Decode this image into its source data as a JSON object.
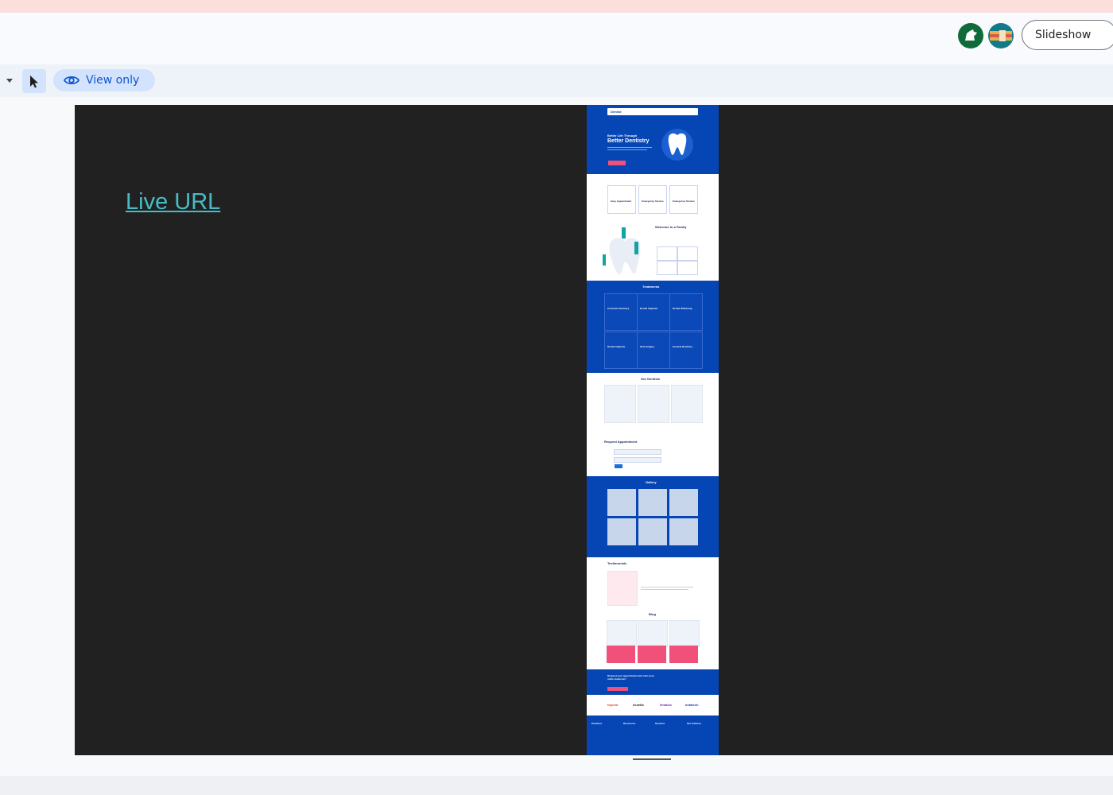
{
  "header": {
    "slideshow_label": "Slideshow"
  },
  "toolbar": {
    "mode_label": "View only"
  },
  "slide": {
    "link_text": "Live URL"
  },
  "preview": {
    "nav_brand": "Dentist",
    "hero_line1": "Better Life Through",
    "hero_line2": "Better Dentistry",
    "services": [
      "Easy Appointment",
      "Emergency Service",
      "Emergency Service"
    ],
    "welcome_title": "Welcome to a Family",
    "treatments_title": "Treatments",
    "treatments": [
      "Cosmetic Dentistry",
      "Dental Implants",
      "Dental Whitening",
      "Dental Implants",
      "Oral Surgery",
      "General Dentistry"
    ],
    "dentists_title": "Our Dentists",
    "appointment_title": "Request Appointment",
    "gallery_title": "Gallery",
    "testimonials_title": "Testimonials",
    "blog_title": "Blog",
    "cta_text": "Request your appointment and start your smile makeover!",
    "partners": [
      "hipcrat",
      "ecoelia",
      "ilmatics",
      "betatech"
    ],
    "footer_cols": [
      "Practices",
      "Resources",
      "Services",
      "Our Address"
    ]
  },
  "colors": {
    "accent": "#0b57d0",
    "link": "#46bdc6",
    "canvas": "#212121",
    "site_blue": "#0645b4",
    "site_pink": "#f0507a"
  }
}
